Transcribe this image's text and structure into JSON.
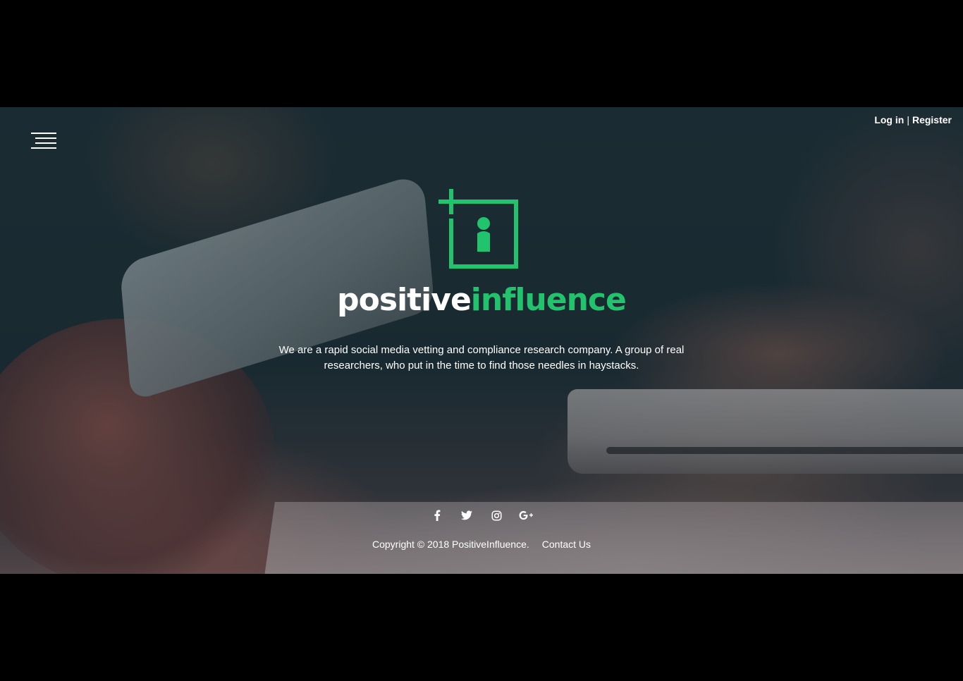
{
  "nav": {
    "menu_icon": "hamburger-menu-icon",
    "login_label": "Log in",
    "separator": "|",
    "register_label": "Register"
  },
  "hero": {
    "logo_icon": "positive-influence-logo-icon",
    "brand_white": "positive",
    "brand_green": "influence",
    "tagline": "We are a rapid social media vetting and compliance research company. A group of real researchers, who put in the time to find those needles in haystacks."
  },
  "social": {
    "icons": [
      "facebook-icon",
      "twitter-icon",
      "instagram-icon",
      "google-plus-icon"
    ]
  },
  "footer": {
    "copyright": "Copyright © 2018 PositiveInfluence.",
    "contact_label": "Contact Us"
  },
  "colors": {
    "brand_green": "#21c36d",
    "text": "#ffffff",
    "letterbox": "#000000"
  }
}
